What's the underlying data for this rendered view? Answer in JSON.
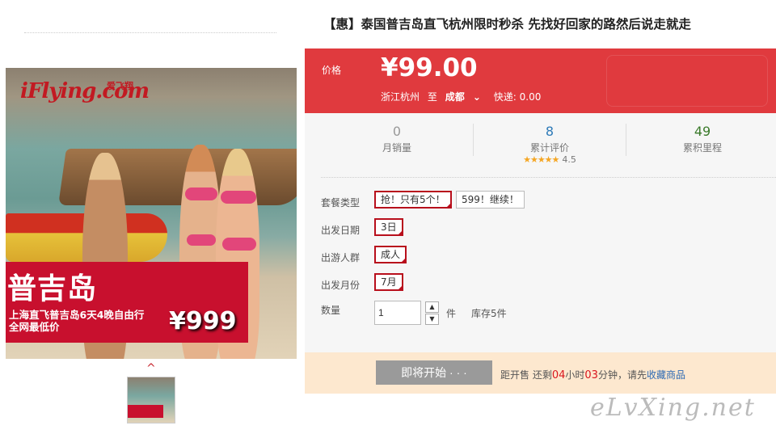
{
  "gallery": {
    "image_logo": "iFlying.com",
    "image_logo_cn": "爱飞翔",
    "image_title": "普吉岛",
    "image_sub_line1": "上海直飞普吉岛6天4晚自由行",
    "image_sub_line2": "全网最低价",
    "image_price": "¥999",
    "thumb_up_arrow": "^"
  },
  "product": {
    "title": "【惠】泰国普吉岛直飞杭州限时秒杀 先找好回家的路然后说走就走"
  },
  "price": {
    "label": "价格",
    "value": "¥99.00",
    "from": "浙江杭州",
    "to_word": "至",
    "destination": "成都",
    "dest_arrow": "⌄",
    "shipping_label": "快递: 0.00"
  },
  "stats": [
    {
      "value": "0",
      "label": "月销量"
    },
    {
      "value": "8",
      "label": "累计评价",
      "stars": "★★★★★",
      "score": "4.5"
    },
    {
      "value": "49",
      "label": "累积里程"
    }
  ],
  "options": {
    "package_label": "套餐类型",
    "package_opt1": "抢！只有5个！",
    "package_opt2": "599！继续！",
    "date_label": "出发日期",
    "date_opt": "3日",
    "people_label": "出游人群",
    "people_opt": "成人",
    "month_label": "出发月份",
    "month_opt": "7月",
    "qty_label": "数量",
    "qty_value": "1",
    "qty_up": "▲",
    "qty_down": "▼",
    "qty_unit": "件",
    "stock": "库存5件"
  },
  "buy": {
    "button": "即将开始 · · ·",
    "pre": "距开售 还剩",
    "hours": "04",
    "hours_unit": "小时",
    "minutes": "03",
    "minutes_unit": "分钟，请先",
    "link": "收藏商品"
  },
  "watermark": "eLvXing.net",
  "colors": {
    "accent": "#e03a3e",
    "selected_border": "#b80f1c",
    "buy_bg": "#fde8cf"
  }
}
